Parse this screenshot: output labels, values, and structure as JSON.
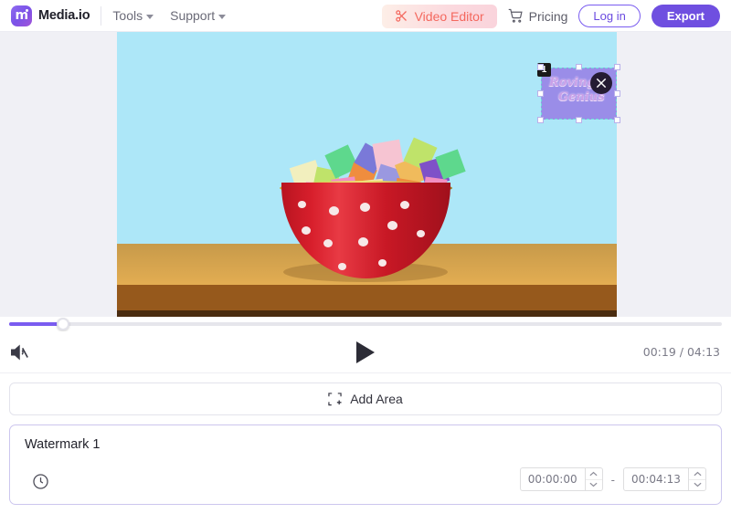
{
  "header": {
    "brand_name": "Media.io",
    "logo_letter": "m",
    "nav": [
      {
        "label": "Tools",
        "icon": "chevron-down-icon"
      },
      {
        "label": "Support",
        "icon": "chevron-down-icon"
      }
    ],
    "video_editor_label": "Video Editor",
    "video_editor_icon": "scissors-icon",
    "pricing_label": "Pricing",
    "pricing_icon": "cart-icon",
    "login_label": "Log in",
    "export_label": "Export",
    "accent_purple": "#6f4fe0",
    "accent_coral": "#f4685e"
  },
  "stage": {
    "video_scene": "red polka-dot bowl filled with colorful cubes on a wooden table",
    "watermark": {
      "badge_number": "1",
      "line1": "Roving",
      "line2": "Genius",
      "logo_icon": "crossed-tools-badge-icon",
      "box_color": "#9a8de8",
      "text_color": "#c9a0e8"
    }
  },
  "player": {
    "progress_percent": 8.5,
    "mute_icon": "speaker-muted-icon",
    "play_icon": "play-icon",
    "current_time": "00:19",
    "total_time": "04:13",
    "time_display": "00:19 / 04:13"
  },
  "add_area": {
    "label": "Add Area",
    "icon": "dashed-square-plus-icon"
  },
  "watermark_panel": {
    "title": "Watermark 1",
    "clock_icon": "clock-icon",
    "start_time": "00:00:00",
    "end_time": "00:04:13",
    "range_separator": "-",
    "spinner_up_icon": "chevron-up-icon",
    "spinner_down_icon": "chevron-down-icon"
  }
}
